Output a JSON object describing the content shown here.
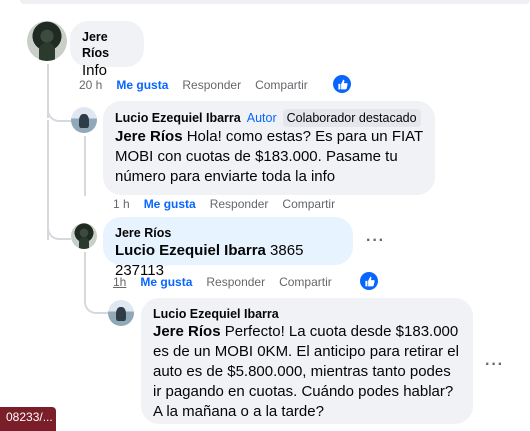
{
  "comments": [
    {
      "author": "Jere Ríos",
      "text": "Info",
      "time": "20 h",
      "like": "Me gusta",
      "reply": "Responder",
      "share": "Compartir"
    },
    {
      "author": "Lucio Ezequiel Ibarra",
      "badge_author": "Autor",
      "badge_contributor": "Colaborador destacado",
      "mention": "Jere Ríos",
      "text": " Hola! como estas? Es para un FIAT MOBI con cuotas de $183.000. Pasame tu número para enviarte toda la info",
      "time": "1 h",
      "like": "Me gusta",
      "reply": "Responder",
      "share": "Compartir"
    },
    {
      "author": "Jere Ríos",
      "mention": "Lucio Ezequiel Ibarra",
      "text": " 3865 237113",
      "time": "1h",
      "like": "Me gusta",
      "reply": "Responder",
      "share": "Compartir",
      "more": "···"
    },
    {
      "author": "Lucio Ezequiel Ibarra",
      "mention": "Jere Ríos",
      "text": " Perfecto! La cuota desde $183.000 es de un MOBI 0KM. El anticipo para retirar el auto es de $5.800.000, mientras tanto podes ir pagando en cuotas. Cuándo podes hablar? A la mañana o a la tarde?",
      "more": "···"
    }
  ],
  "bottom_tag": "08233/...",
  "colors": {
    "accent": "#0866ff",
    "bubble": "#f0f2f5",
    "bubble_highlight": "#e7f3ff"
  },
  "icons": {
    "reaction": "thumbs-up-icon",
    "more": "more-icon"
  }
}
